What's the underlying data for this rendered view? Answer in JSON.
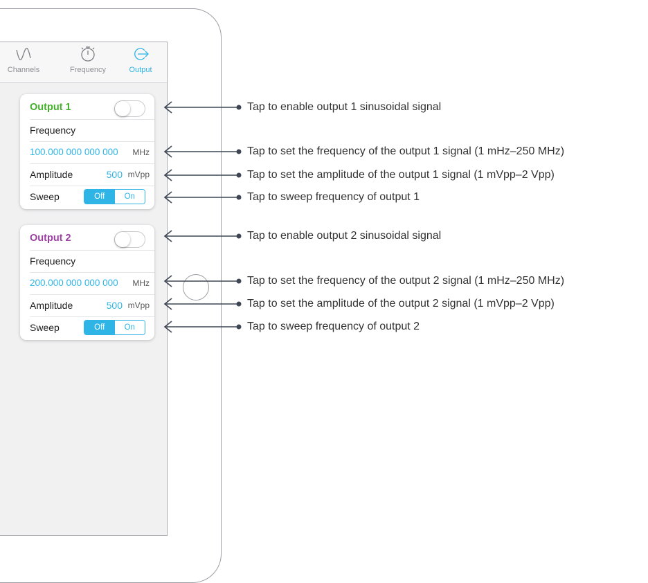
{
  "tabs": [
    {
      "label": "Channels",
      "icon": "sine-wave-icon"
    },
    {
      "label": "Frequency",
      "icon": "stopwatch-icon"
    },
    {
      "label": "Output",
      "icon": "output-arrow-icon"
    }
  ],
  "output1": {
    "title": "Output 1",
    "title_color": "#43b02a",
    "enabled": false,
    "frequency_label": "Frequency",
    "frequency_value": "100.000 000 000 000",
    "frequency_unit": "MHz",
    "amplitude_label": "Amplitude",
    "amplitude_value": "500",
    "amplitude_unit": "mVpp",
    "sweep_label": "Sweep",
    "sweep_off": "Off",
    "sweep_on": "On",
    "sweep_selected": "Off"
  },
  "output2": {
    "title": "Output 2",
    "title_color": "#9b3fa0",
    "enabled": false,
    "frequency_label": "Frequency",
    "frequency_value": "200.000 000 000 000",
    "frequency_unit": "MHz",
    "amplitude_label": "Amplitude",
    "amplitude_value": "500",
    "amplitude_unit": "mVpp",
    "sweep_label": "Sweep",
    "sweep_off": "Off",
    "sweep_on": "On",
    "sweep_selected": "Off"
  },
  "callouts": [
    "Tap to enable output 1 sinusoidal signal",
    "Tap to set the frequency of the output 1 signal (1 mHz–250 MHz)",
    "Tap to set the amplitude of the output 1 signal (1 mVpp–2 Vpp)",
    "Tap to sweep frequency of output 1",
    "Tap to enable output 2 sinusoidal signal",
    "Tap to set the frequency of the output 2 signal (1 mHz–250 MHz)",
    "Tap to set the amplitude of the output 2 signal (1 mVpp–2 Vpp)",
    "Tap to sweep frequency of output 2"
  ],
  "colors": {
    "accent": "#2fb4e6",
    "annotation_line": "#3e4654"
  }
}
